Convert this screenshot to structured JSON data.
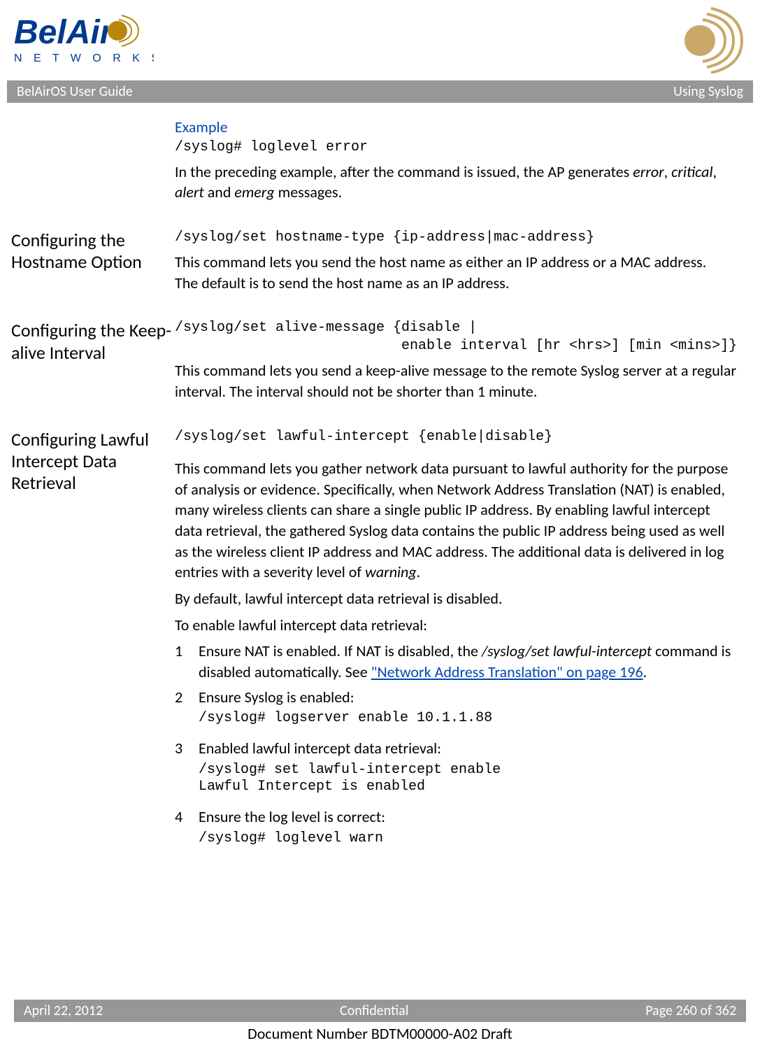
{
  "header": {
    "guide": "BelAirOS User Guide",
    "chapter": "Using Syslog"
  },
  "example": {
    "label": "Example",
    "code": "/syslog# loglevel error",
    "desc_prefix": "In the preceding example, after the command is issued, the AP generates ",
    "w_error": "error",
    "w_comma1": ", ",
    "w_critical": "critical",
    "w_comma2": ", ",
    "w_alert": "alert",
    "w_and": " and ",
    "w_emerg": "emerg",
    "desc_suffix": " messages."
  },
  "hostname": {
    "heading": "Configuring the Hostname Option",
    "code": "/syslog/set hostname-type {ip-address|mac-address}",
    "desc": "This command lets you send the host name as either an IP address or a MAC address. The default is to send the host name as an IP address."
  },
  "keepalive": {
    "heading": "Configuring the Keep-alive Interval",
    "code1": "/syslog/set alive-message {disable |",
    "code2": "                           enable interval [hr <hrs>] [min <mins>]}",
    "desc": "This command lets you send a keep-alive message to the remote Syslog server at a regular interval. The interval should not be shorter than 1 minute."
  },
  "lawful": {
    "heading": "Configuring Lawful Intercept Data Retrieval",
    "code": "/syslog/set lawful-intercept {enable|disable}",
    "desc_prefix": "This command lets you gather network data pursuant to lawful authority for the purpose of analysis or evidence. Specifically, when Network Address Translation (NAT) is enabled, many wireless clients can share a single public IP address. By enabling lawful intercept data retrieval, the gathered Syslog data contains the public IP address being used as well as the wireless client IP address and MAC address. The additional data is delivered in log entries with a severity level of ",
    "w_warning": "warning",
    "desc_suffix": ".",
    "default_note": "By default, lawful intercept data retrieval is disabled.",
    "enable_intro": "To enable lawful intercept data retrieval:",
    "steps": [
      {
        "num": "1",
        "text_prefix": "Ensure NAT is enabled. If NAT is disabled, the ",
        "text_cmd": "/syslog/set lawful-intercept",
        "text_mid": " command is disabled automatically. See ",
        "link": "\"Network Address Translation\" on page 196",
        "text_suffix": "."
      },
      {
        "num": "2",
        "text": "Ensure Syslog is enabled:",
        "code": "/syslog# logserver enable 10.1.1.88"
      },
      {
        "num": "3",
        "text": "Enabled lawful intercept data retrieval:",
        "code": "/syslog# set lawful-intercept enable\nLawful Intercept is enabled"
      },
      {
        "num": "4",
        "text": "Ensure the log level is correct:",
        "code": "/syslog# loglevel warn"
      }
    ]
  },
  "footer": {
    "date": "April 22, 2012",
    "conf": "Confidential",
    "page": "Page 260 of 362",
    "docnum": "Document Number BDTM00000-A02 Draft"
  }
}
